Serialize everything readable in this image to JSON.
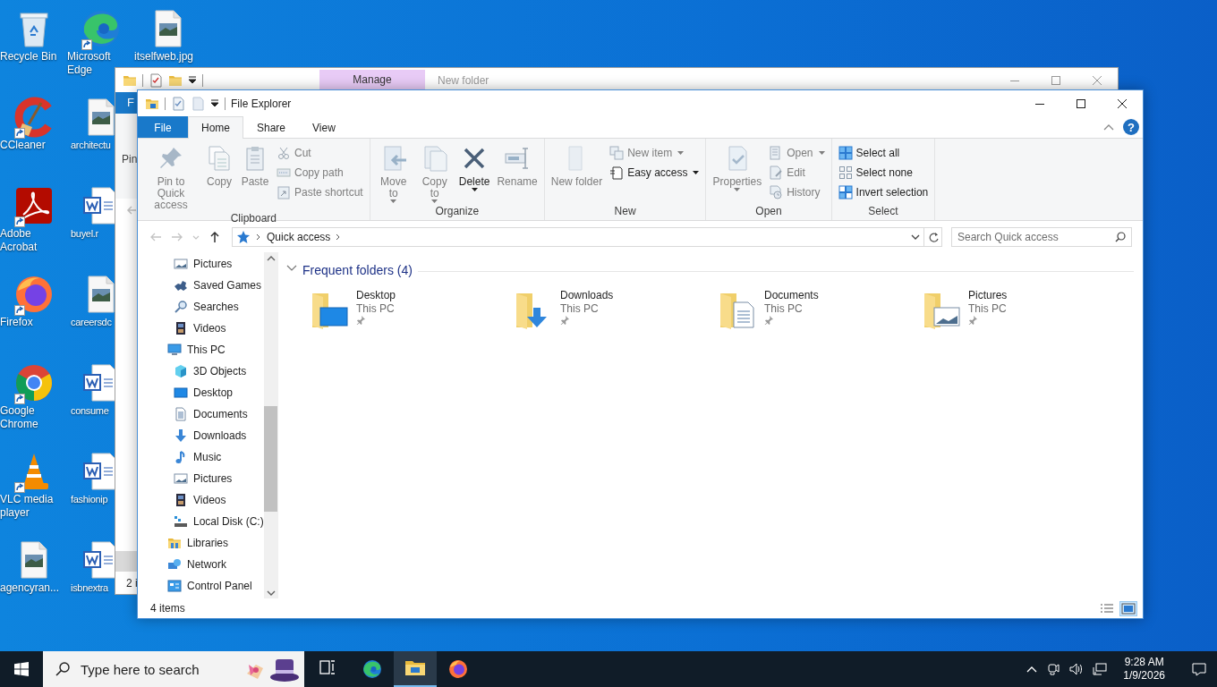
{
  "desktop": {
    "icons": [
      {
        "label": "Recycle Bin",
        "kind": "recycle",
        "shortcut": false
      },
      {
        "label": "CCleaner",
        "kind": "ccleaner",
        "shortcut": true
      },
      {
        "label": "Adobe Acrobat",
        "kind": "acrobat",
        "shortcut": true
      },
      {
        "label": "Firefox",
        "kind": "firefox",
        "shortcut": true
      },
      {
        "label": "Google Chrome",
        "kind": "chrome",
        "shortcut": true
      },
      {
        "label": "VLC media player",
        "kind": "vlc",
        "shortcut": true
      },
      {
        "label": "agencyran...",
        "kind": "image",
        "shortcut": false
      },
      {
        "label": "Microsoft Edge",
        "kind": "edge",
        "shortcut": true
      },
      {
        "label": "architectu",
        "kind": "image",
        "shortcut": false
      },
      {
        "label": "buyel.r",
        "kind": "word",
        "shortcut": false
      },
      {
        "label": "careersdc",
        "kind": "image",
        "shortcut": false
      },
      {
        "label": "consume",
        "kind": "word",
        "shortcut": false
      },
      {
        "label": "fashionip",
        "kind": "word",
        "shortcut": false
      },
      {
        "label": "isbnextra",
        "kind": "word",
        "shortcut": false
      },
      {
        "label": "itselfweb.jpg",
        "kind": "image",
        "shortcut": false
      }
    ]
  },
  "back_window": {
    "context_tab": "Manage",
    "title": "New folder",
    "tab": "F",
    "ribbon_text": "Pin",
    "status": "2 i"
  },
  "explorer": {
    "title": "File Explorer",
    "tabs": [
      {
        "label": "File",
        "kind": "file",
        "selected": false
      },
      {
        "label": "Home",
        "kind": "tab",
        "selected": true
      },
      {
        "label": "Share",
        "kind": "tab",
        "selected": false
      },
      {
        "label": "View",
        "kind": "tab",
        "selected": false
      }
    ],
    "help": "?",
    "ribbon": [
      {
        "label": "Clipboard",
        "items": [
          {
            "label": "Pin to Quick access",
            "kind": "large",
            "disabled": true
          },
          {
            "label": "Copy",
            "kind": "large",
            "disabled": true
          },
          {
            "label": "Paste",
            "kind": "large",
            "disabled": true
          },
          {
            "label": "Cut",
            "kind": "small",
            "disabled": true
          },
          {
            "label": "Copy path",
            "kind": "small",
            "disabled": true
          },
          {
            "label": "Paste shortcut",
            "kind": "small",
            "disabled": true
          }
        ]
      },
      {
        "label": "Organize",
        "items": [
          {
            "label": "Move to",
            "kind": "large",
            "disabled": true,
            "dropdown": true
          },
          {
            "label": "Copy to",
            "kind": "large",
            "disabled": true,
            "dropdown": true
          },
          {
            "label": "Delete",
            "kind": "large",
            "disabled": false,
            "dropdown": true
          },
          {
            "label": "Rename",
            "kind": "large",
            "disabled": true
          }
        ]
      },
      {
        "label": "New",
        "items": [
          {
            "label": "New folder",
            "kind": "large",
            "disabled": true
          },
          {
            "label": "New item",
            "kind": "small",
            "disabled": true,
            "dropdown": true
          },
          {
            "label": "Easy access",
            "kind": "small",
            "disabled": false,
            "dropdown": true
          }
        ]
      },
      {
        "label": "Open",
        "items": [
          {
            "label": "Properties",
            "kind": "large",
            "disabled": true,
            "dropdown": true
          },
          {
            "label": "Open",
            "kind": "small",
            "disabled": true,
            "dropdown": true
          },
          {
            "label": "Edit",
            "kind": "small",
            "disabled": true
          },
          {
            "label": "History",
            "kind": "small",
            "disabled": true
          }
        ]
      },
      {
        "label": "Select",
        "items": [
          {
            "label": "Select all",
            "kind": "small",
            "disabled": false
          },
          {
            "label": "Select none",
            "kind": "small",
            "disabled": false
          },
          {
            "label": "Invert selection",
            "kind": "small",
            "disabled": false
          }
        ]
      }
    ],
    "nav_buttons": [
      {
        "kind": "back",
        "disabled": true
      },
      {
        "kind": "forward",
        "disabled": true
      },
      {
        "kind": "recent",
        "disabled": true
      },
      {
        "kind": "up",
        "disabled": false
      }
    ],
    "breadcrumb": [
      "Quick access"
    ],
    "search_placeholder": "Search Quick access",
    "nav_tree": [
      {
        "children": [
          {
            "label": "Pictures",
            "kind": "pictures"
          },
          {
            "label": "Saved Games",
            "kind": "games"
          },
          {
            "label": "Searches",
            "kind": "search"
          },
          {
            "label": "Videos",
            "kind": "videos"
          }
        ]
      },
      {
        "label": "This PC",
        "kind": "pc",
        "children": [
          {
            "label": "3D Objects",
            "kind": "cube"
          },
          {
            "label": "Desktop",
            "kind": "desktop"
          },
          {
            "label": "Documents",
            "kind": "documents"
          },
          {
            "label": "Downloads",
            "kind": "downloads"
          },
          {
            "label": "Music",
            "kind": "music"
          },
          {
            "label": "Pictures",
            "kind": "pictures"
          },
          {
            "label": "Videos",
            "kind": "videos"
          },
          {
            "label": "Local Disk (C:)",
            "kind": "disk"
          }
        ]
      },
      {
        "label": "Libraries",
        "kind": "libraries"
      },
      {
        "label": "Network",
        "kind": "network"
      },
      {
        "label": "Control Panel",
        "kind": "control"
      }
    ],
    "section": {
      "title": "Frequent folders (4)",
      "expanded": true
    },
    "folders": [
      {
        "name": "Desktop",
        "location": "This PC",
        "kind": "desktop",
        "pinned": true
      },
      {
        "name": "Downloads",
        "location": "This PC",
        "kind": "downloads",
        "pinned": true
      },
      {
        "name": "Documents",
        "location": "This PC",
        "kind": "documents",
        "pinned": true
      },
      {
        "name": "Pictures",
        "location": "This PC",
        "kind": "pictures",
        "pinned": true
      }
    ],
    "status": "4 items",
    "views": [
      {
        "kind": "details",
        "selected": false
      },
      {
        "kind": "tiles",
        "selected": true
      }
    ]
  },
  "taskbar": {
    "search_placeholder": "Type here to search",
    "apps": [
      {
        "kind": "taskview",
        "active": false
      },
      {
        "kind": "edge",
        "active": false
      },
      {
        "kind": "explorer",
        "active": true
      },
      {
        "kind": "firefox",
        "active": false
      }
    ],
    "time": "9:28 AM",
    "date": "1/9/2026"
  }
}
